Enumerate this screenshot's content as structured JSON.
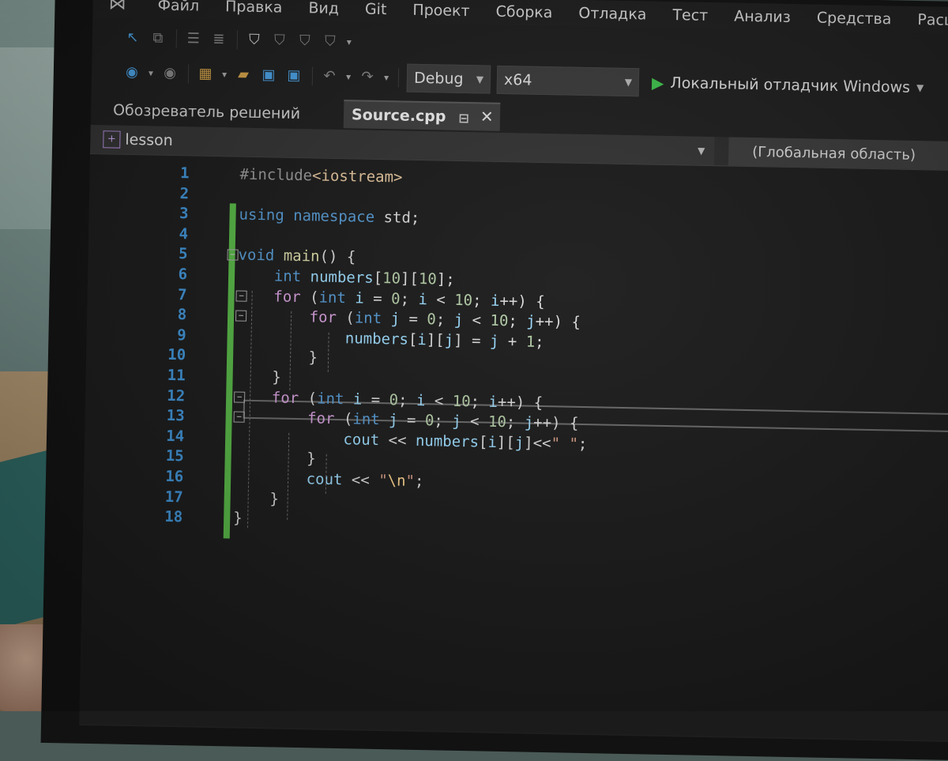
{
  "menu": {
    "items": [
      "Файл",
      "Правка",
      "Вид",
      "Git",
      "Проект",
      "Сборка",
      "Отладка",
      "Тест",
      "Анализ",
      "Средства",
      "Расширения"
    ]
  },
  "toolbar": {
    "configuration": "Debug",
    "platform": "x64",
    "run_label": "Локальный отладчик Windows"
  },
  "tabs": {
    "solution_explorer": "Обозреватель решений",
    "active_file": "Source.cpp"
  },
  "navbar": {
    "project": "lesson",
    "scope": "(Глобальная область)"
  },
  "code": {
    "lines": [
      {
        "n": "1",
        "tokens": [
          [
            "pp",
            "#include"
          ],
          [
            "inc",
            "<iostream>"
          ]
        ]
      },
      {
        "n": "2",
        "tokens": []
      },
      {
        "n": "3",
        "tokens": [
          [
            "kw",
            "using"
          ],
          [
            "txt",
            " "
          ],
          [
            "kw",
            "namespace"
          ],
          [
            "txt",
            " std;"
          ]
        ]
      },
      {
        "n": "4",
        "tokens": []
      },
      {
        "n": "5",
        "tokens": [
          [
            "kw",
            "void"
          ],
          [
            "txt",
            " "
          ],
          [
            "fn",
            "main"
          ],
          [
            "txt",
            "() {"
          ]
        ]
      },
      {
        "n": "6",
        "tokens": [
          [
            "txt",
            "    "
          ],
          [
            "kw",
            "int"
          ],
          [
            "txt",
            " "
          ],
          [
            "id",
            "numbers"
          ],
          [
            "txt",
            "["
          ],
          [
            "num",
            "10"
          ],
          [
            "txt",
            "]["
          ],
          [
            "num",
            "10"
          ],
          [
            "txt",
            "];"
          ]
        ]
      },
      {
        "n": "7",
        "tokens": [
          [
            "txt",
            "    "
          ],
          [
            "ctl",
            "for"
          ],
          [
            "txt",
            " ("
          ],
          [
            "kw",
            "int"
          ],
          [
            "txt",
            " "
          ],
          [
            "id",
            "i"
          ],
          [
            "txt",
            " = "
          ],
          [
            "num",
            "0"
          ],
          [
            "txt",
            "; "
          ],
          [
            "id",
            "i"
          ],
          [
            "txt",
            " < "
          ],
          [
            "num",
            "10"
          ],
          [
            "txt",
            "; "
          ],
          [
            "id",
            "i"
          ],
          [
            "txt",
            "++) {"
          ]
        ]
      },
      {
        "n": "8",
        "tokens": [
          [
            "txt",
            "        "
          ],
          [
            "ctl",
            "for"
          ],
          [
            "txt",
            " ("
          ],
          [
            "kw",
            "int"
          ],
          [
            "txt",
            " "
          ],
          [
            "id",
            "j"
          ],
          [
            "txt",
            " = "
          ],
          [
            "num",
            "0"
          ],
          [
            "txt",
            "; "
          ],
          [
            "id",
            "j"
          ],
          [
            "txt",
            " < "
          ],
          [
            "num",
            "10"
          ],
          [
            "txt",
            "; "
          ],
          [
            "id",
            "j"
          ],
          [
            "txt",
            "++) {"
          ]
        ]
      },
      {
        "n": "9",
        "tokens": [
          [
            "txt",
            "            "
          ],
          [
            "id",
            "numbers"
          ],
          [
            "txt",
            "["
          ],
          [
            "id",
            "i"
          ],
          [
            "txt",
            "]["
          ],
          [
            "id",
            "j"
          ],
          [
            "txt",
            "] = "
          ],
          [
            "id",
            "j"
          ],
          [
            "txt",
            " + "
          ],
          [
            "num",
            "1"
          ],
          [
            "txt",
            ";"
          ]
        ]
      },
      {
        "n": "10",
        "tokens": [
          [
            "txt",
            "        }"
          ]
        ]
      },
      {
        "n": "11",
        "tokens": [
          [
            "txt",
            "    }"
          ]
        ]
      },
      {
        "n": "12",
        "tokens": [
          [
            "txt",
            "    "
          ],
          [
            "ctl",
            "for"
          ],
          [
            "txt",
            " ("
          ],
          [
            "kw",
            "int"
          ],
          [
            "txt",
            " "
          ],
          [
            "id",
            "i"
          ],
          [
            "txt",
            " = "
          ],
          [
            "num",
            "0"
          ],
          [
            "txt",
            "; "
          ],
          [
            "id",
            "i"
          ],
          [
            "txt",
            " < "
          ],
          [
            "num",
            "10"
          ],
          [
            "txt",
            "; "
          ],
          [
            "id",
            "i"
          ],
          [
            "txt",
            "++) {"
          ]
        ]
      },
      {
        "n": "13",
        "tokens": [
          [
            "txt",
            "        "
          ],
          [
            "ctl",
            "for"
          ],
          [
            "txt",
            " ("
          ],
          [
            "kw",
            "int"
          ],
          [
            "txt",
            " "
          ],
          [
            "id",
            "j"
          ],
          [
            "txt",
            " = "
          ],
          [
            "num",
            "0"
          ],
          [
            "txt",
            "; "
          ],
          [
            "id",
            "j"
          ],
          [
            "txt",
            " < "
          ],
          [
            "num",
            "10"
          ],
          [
            "txt",
            "; "
          ],
          [
            "id",
            "j"
          ],
          [
            "txt",
            "++) {"
          ]
        ]
      },
      {
        "n": "14",
        "tokens": [
          [
            "txt",
            "            "
          ],
          [
            "id",
            "cout"
          ],
          [
            "txt",
            " << "
          ],
          [
            "id",
            "numbers"
          ],
          [
            "txt",
            "["
          ],
          [
            "id",
            "i"
          ],
          [
            "txt",
            "]["
          ],
          [
            "id",
            "j"
          ],
          [
            "txt",
            "]<<"
          ],
          [
            "str",
            "\" \""
          ],
          [
            "txt",
            ";"
          ]
        ]
      },
      {
        "n": "15",
        "tokens": [
          [
            "txt",
            "        }"
          ]
        ]
      },
      {
        "n": "16",
        "tokens": [
          [
            "txt",
            "        "
          ],
          [
            "id",
            "cout"
          ],
          [
            "txt",
            " << "
          ],
          [
            "str",
            "\""
          ],
          [
            "esc",
            "\\n"
          ],
          [
            "str",
            "\""
          ],
          [
            "txt",
            ";"
          ]
        ]
      },
      {
        "n": "17",
        "tokens": [
          [
            "txt",
            "    }"
          ]
        ]
      },
      {
        "n": "18",
        "tokens": [
          [
            "txt",
            "}"
          ]
        ]
      }
    ],
    "fold_lines": [
      "5",
      "7",
      "8",
      "12",
      "13"
    ],
    "current_line": "12"
  },
  "colors": {
    "keyword": "#569cd6",
    "control": "#d8a0df",
    "string": "#d69d85",
    "number": "#b5cea8",
    "identifier": "#9cdcfe",
    "line_number": "#3f94d8",
    "change_bar": "#57b846",
    "run_icon": "#3fc24d"
  },
  "icons": {
    "logo": "visual-studio-logo",
    "run": "play-icon",
    "pin": "pin-icon",
    "close": "close-icon"
  }
}
